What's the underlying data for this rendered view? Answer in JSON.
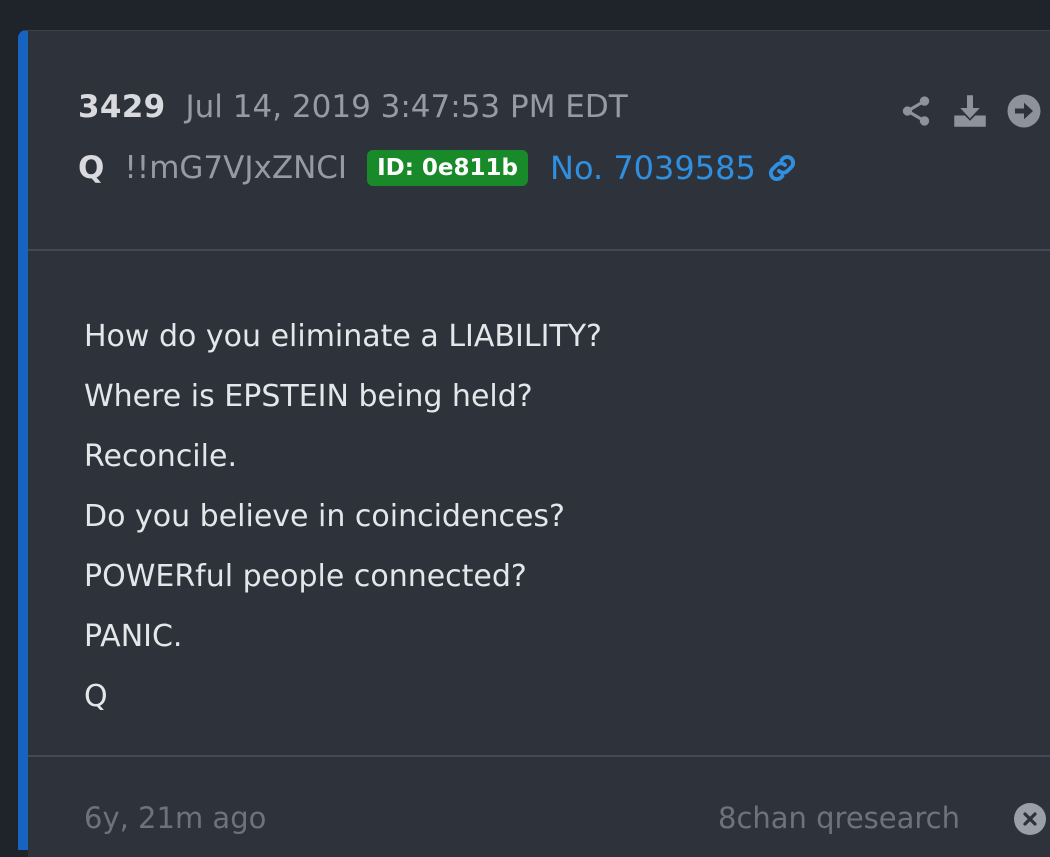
{
  "post": {
    "number": "3429",
    "timestamp": "Jul 14, 2019 3:47:53 PM EDT",
    "author": "Q",
    "tripcode": "!!mG7VJxZNCI",
    "id_badge": "ID: 0e811b",
    "post_link": "No. 7039585",
    "body_lines": [
      "How do you eliminate a LIABILITY?",
      "Where is EPSTEIN being held?",
      "Reconcile.",
      "Do you believe in coincidences?",
      "POWERful people connected?",
      "PANIC.",
      "Q"
    ],
    "time_ago": "6y, 21m ago",
    "source": "8chan qresearch"
  },
  "icons": {
    "share": "share-icon",
    "download": "download-icon",
    "next": "arrow-right-circle-icon",
    "link": "link-icon",
    "close": "close-circle-icon"
  },
  "colors": {
    "accent_bar": "#1664c0",
    "id_badge_bg": "#198a2a",
    "link": "#2f8fe0",
    "card_bg": "#2e333b",
    "page_bg": "#1f232a"
  }
}
